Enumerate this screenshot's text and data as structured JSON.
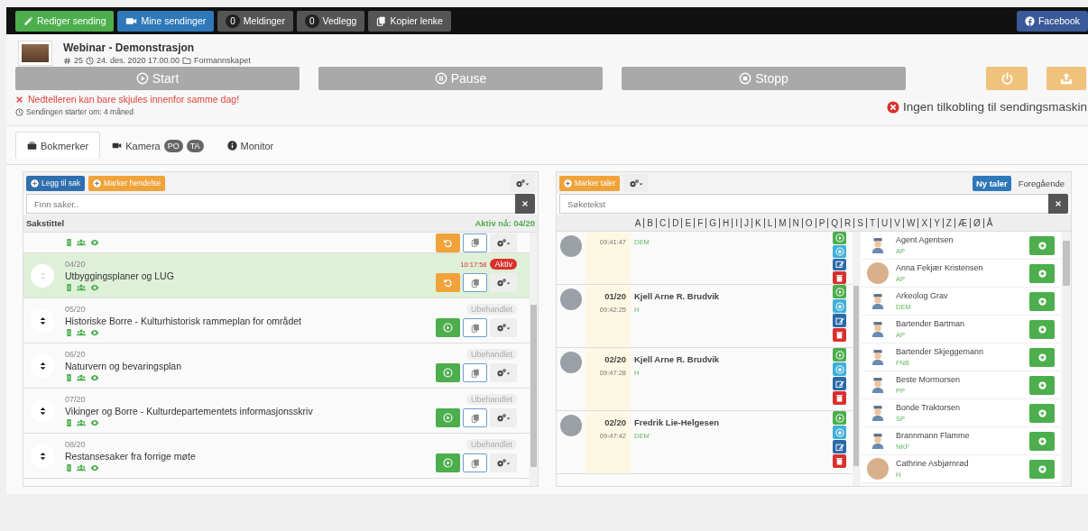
{
  "toolbar": {
    "buttons": [
      {
        "kind": "edit",
        "label": "Rediger sending"
      },
      {
        "kind": "video",
        "label": "Mine sendinger"
      },
      {
        "kind": "count",
        "count": "0",
        "label": "Meldinger"
      },
      {
        "kind": "count",
        "count": "0",
        "label": "Vedlegg"
      },
      {
        "kind": "copy",
        "label": "Kopier lenke"
      }
    ],
    "share_button": "Facebook"
  },
  "broadcast": {
    "title": "Webinar - Demonstrasjon",
    "number": "25",
    "datetime": "24. des. 2020 17.00.00",
    "group": "Formannskapet"
  },
  "controls": [
    {
      "kind": "play",
      "label": "Start"
    },
    {
      "kind": "pause",
      "label": "Pause"
    },
    {
      "kind": "stop",
      "label": "Stopp"
    }
  ],
  "error_message": "Nedtelleren kan bare skjules innenfor samme dag!",
  "countdown": "Sendingen starter om: 4 måned",
  "connection_status": "Ingen tilkobling til sendingsmaskin",
  "tabs": [
    {
      "kind": "briefcase",
      "label": "Bokmerker",
      "selected": true
    },
    {
      "kind": "camera",
      "label": "Kamera",
      "badges": [
        "PO",
        "TA"
      ],
      "selected": false
    },
    {
      "kind": "info",
      "label": "Monitor",
      "selected": false
    }
  ],
  "agenda": {
    "add_button": "Legg til sak",
    "mark_button": "Marker hendelse",
    "search_placeholder": "Finn saker..",
    "column_title": "Sakstittel",
    "active_now": "Aktiv nå: 04/20",
    "items": [
      {
        "kind": "handled",
        "active": false
      },
      {
        "kind": "handled",
        "active": true,
        "number": "04/20",
        "title": "Utbyggingsplaner og LUG",
        "time": "10:17:58",
        "badge": "Aktiv"
      },
      {
        "kind": "pending",
        "active": false,
        "number": "05/20",
        "title": "Historiske Borre - Kulturhistorisk rammeplan for området",
        "badge": "Ubehandlet"
      },
      {
        "kind": "pending",
        "active": false,
        "number": "06/20",
        "title": "Naturvern og bevaringsplan",
        "badge": "Ubehandlet"
      },
      {
        "kind": "pending",
        "active": false,
        "number": "07/20",
        "title": "Vikinger og Borre - Kulturdepartementets informasjonsskriv",
        "badge": "Ubehandlet"
      },
      {
        "kind": "pending",
        "active": false,
        "number": "08/20",
        "title": "Restansesaker fra forrige møte",
        "badge": "Ubehandlet"
      }
    ]
  },
  "speakers": {
    "mark_button": "Marker taler",
    "search_placeholder": "Søketekst",
    "modes": [
      {
        "label": "Ny taler",
        "selected": true
      },
      {
        "label": "Foregående",
        "selected": false
      }
    ],
    "letters": [
      "A",
      "B",
      "C",
      "D",
      "E",
      "F",
      "G",
      "H",
      "I",
      "J",
      "K",
      "L",
      "M",
      "N",
      "O",
      "P",
      "Q",
      "R",
      "S",
      "T",
      "U",
      "V",
      "W",
      "X",
      "Y",
      "Z",
      "Æ",
      "Ø",
      "Å"
    ],
    "queue": [
      {
        "time": "09:41:47",
        "party": "DEM"
      },
      {
        "number": "01/20",
        "name": "Kjell Arne R. Brudvik",
        "time": "09:42:25",
        "party": "H"
      },
      {
        "number": "02/20",
        "name": "Kjell Arne R. Brudvik",
        "time": "09:47:28",
        "party": "H"
      },
      {
        "number": "02/20",
        "name": "Fredrik Lie-Helgesen",
        "time": "09:47:42",
        "party": "DEM"
      }
    ],
    "people": [
      {
        "kind": "figure",
        "name": "Agent Agentsen",
        "party": "AP"
      },
      {
        "kind": "photo",
        "name": "Anna Fekjær Kristensen",
        "party": "AP"
      },
      {
        "kind": "figure",
        "name": "Arkeolog Grav",
        "party": "DEM"
      },
      {
        "kind": "figure",
        "name": "Bartender Bartman",
        "party": "AP"
      },
      {
        "kind": "figure",
        "name": "Bartender Skjeggemann",
        "party": "FNB"
      },
      {
        "kind": "figure",
        "name": "Beste Mormorsen",
        "party": "PP"
      },
      {
        "kind": "figure",
        "name": "Bonde Traktorsen",
        "party": "SP"
      },
      {
        "kind": "figure",
        "name": "Brannmann Flamme",
        "party": "NKF"
      },
      {
        "kind": "photo",
        "name": "Cathrine Asbjørnrød",
        "party": "H"
      }
    ]
  }
}
